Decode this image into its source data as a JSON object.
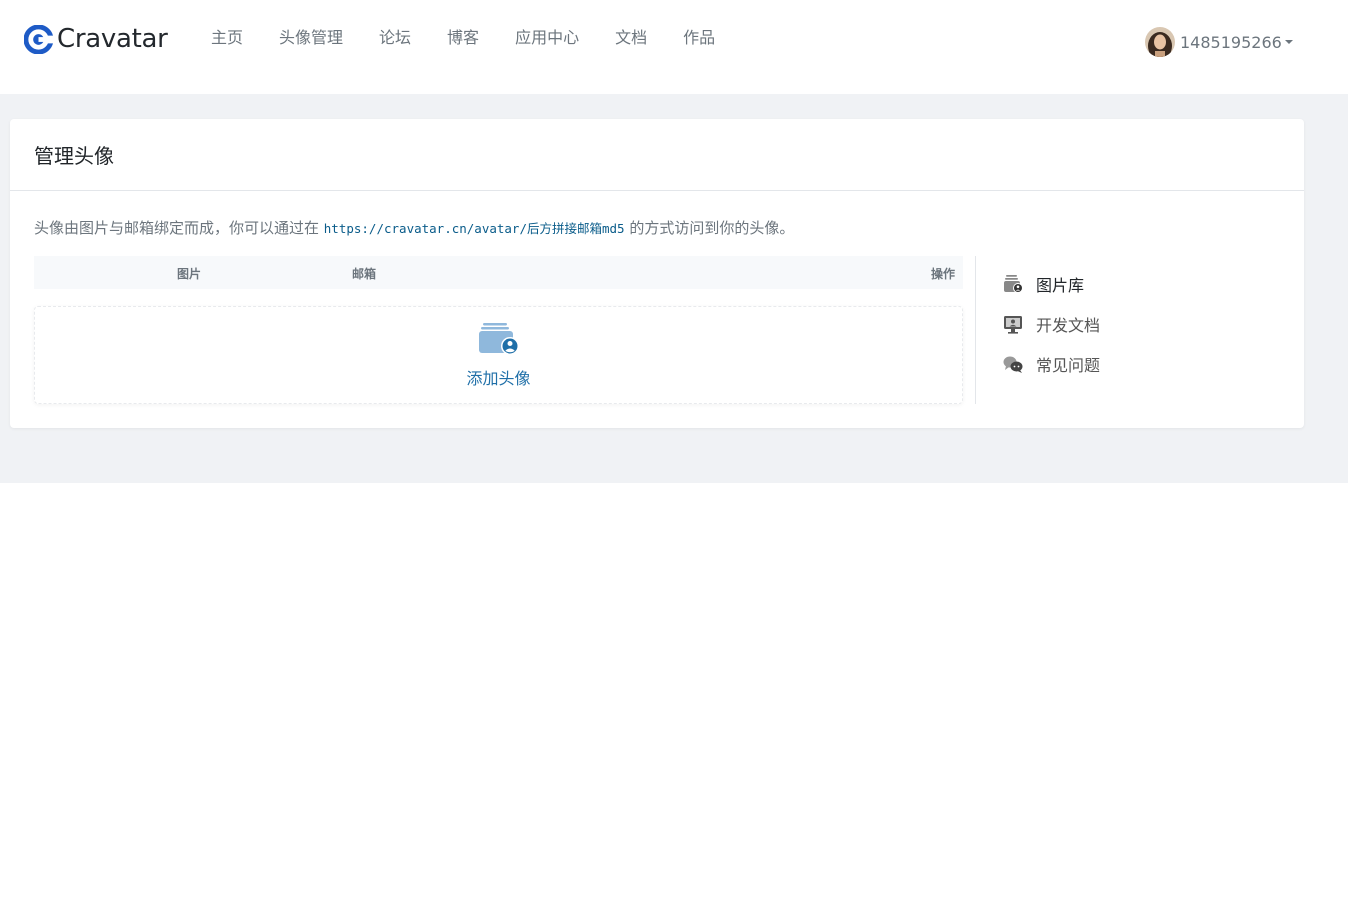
{
  "brand": {
    "name": "Cravatar",
    "accent": "#1e5bc6"
  },
  "nav": {
    "links": [
      "主页",
      "头像管理",
      "论坛",
      "博客",
      "应用中心",
      "文档",
      "作品"
    ]
  },
  "user": {
    "name": "1485195266"
  },
  "card": {
    "title": "管理头像",
    "intro_before": "头像由图片与邮箱绑定而成，你可以通过在 ",
    "intro_code": "https://cravatar.cn/avatar/后方拼接邮箱md5",
    "intro_after": " 的方式访问到你的头像。",
    "table": {
      "col_image": "图片",
      "col_email": "邮箱",
      "col_action": "操作"
    },
    "add_label": "添加头像"
  },
  "sidebar": {
    "items": [
      {
        "label": "图片库",
        "icon": "image-library-icon"
      },
      {
        "label": "开发文档",
        "icon": "dev-docs-icon"
      },
      {
        "label": "常见问题",
        "icon": "faq-icon"
      }
    ]
  }
}
